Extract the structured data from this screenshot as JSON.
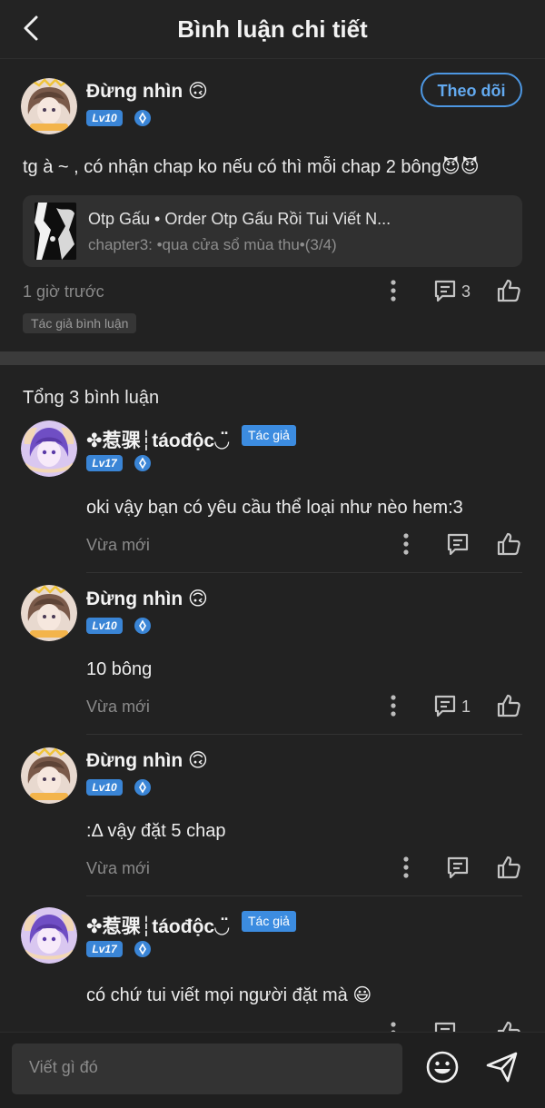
{
  "header": {
    "title": "Bình luận chi tiết"
  },
  "main_comment": {
    "user": "Đừng nhìn 🙃",
    "level": "Lv10",
    "follow_label": "Theo dõi",
    "text": "tg à ~ , có nhận chap ko nếu có thì mỗi chap 2 bông😈😈",
    "story_card": {
      "title": "Otp Gấu • Order Otp Gấu Rồi Tui Viết N...",
      "subtitle": "chapter3: •qua cửa sổ mùa thu•(3/4)"
    },
    "time": "1 giờ trước",
    "reply_count": "3",
    "author_tag": "Tác giả bình luận"
  },
  "replies_total": "Tổng 3 bình luận",
  "replies": [
    {
      "user": "✤惹骒┆táođộc◡̈",
      "level": "Lv17",
      "author_badge": "Tác giả",
      "text": "oki vậy bạn có yêu cầu thể loại như nèo hem:3",
      "time": "Vừa mới",
      "reply_count": ""
    },
    {
      "user": "Đừng nhìn 🙃",
      "level": "Lv10",
      "author_badge": "",
      "text": "10 bông",
      "time": "Vừa mới",
      "reply_count": "1"
    },
    {
      "user": "Đừng nhìn 🙃",
      "level": "Lv10",
      "author_badge": "",
      "text": ":Δ vậy đặt 5 chap",
      "time": "Vừa mới",
      "reply_count": ""
    },
    {
      "user": "✤惹骒┆táođộc◡̈",
      "level": "Lv17",
      "author_badge": "Tác giả",
      "text": "có chứ tui viết mọi người đặt mà 😃",
      "time": "",
      "reply_count": ""
    }
  ],
  "composer": {
    "placeholder": "Viết gì đó"
  },
  "colors": {
    "accent": "#3c8ce0",
    "background": "#222222",
    "follow_border": "#4d97e2"
  },
  "icons": [
    "back-icon",
    "more-icon",
    "comment-icon",
    "like-icon",
    "emoji-icon",
    "send-icon",
    "level-icon",
    "crown-icon"
  ]
}
